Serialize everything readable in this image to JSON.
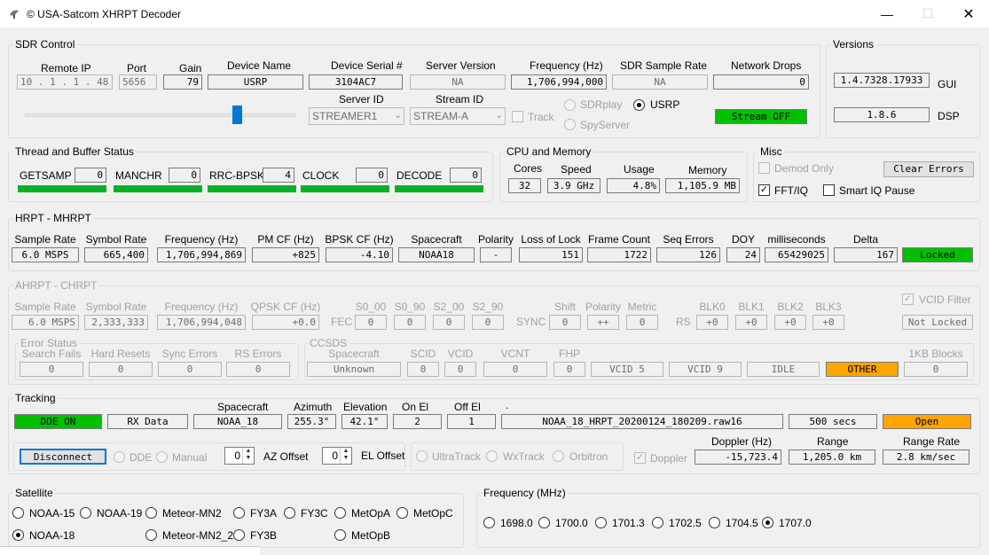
{
  "window": {
    "title": "© USA-Satcom XHRPT Decoder"
  },
  "sdr": {
    "group_title": "SDR Control",
    "remote_ip_label": "Remote IP",
    "remote_ip": "10 . 1 . 1 . 48",
    "port_label": "Port",
    "port": "5656",
    "gain_label": "Gain",
    "gain": "79",
    "device_name_label": "Device Name",
    "device_name": "USRP",
    "device_serial_label": "Device Serial #",
    "device_serial": "3104AC7",
    "server_version_label": "Server Version",
    "server_version": "NA",
    "frequency_label": "Frequency (Hz)",
    "frequency": "1,706,994,000",
    "sample_rate_label": "SDR Sample Rate",
    "sample_rate": "NA",
    "network_drops_label": "Network Drops",
    "network_drops": "0",
    "server_id_label": "Server ID",
    "server_id": "STREAMER1",
    "stream_id_label": "Stream ID",
    "stream_id": "STREAM-A",
    "track_label": "Track",
    "sdrplay_label": "SDRplay",
    "spyserver_label": "SpyServer",
    "usrp_label": "USRP",
    "stream_status": "Stream OFF"
  },
  "versions": {
    "group_title": "Versions",
    "gui": "1.4.7328.17933",
    "gui_label": "GUI",
    "dsp": "1.8.6",
    "dsp_label": "DSP"
  },
  "threads": {
    "group_title": "Thread and Buffer Status",
    "items": [
      {
        "label": "GETSAMP",
        "value": "0"
      },
      {
        "label": "MANCHR",
        "value": "0"
      },
      {
        "label": "RRC-BPSK",
        "value": "4"
      },
      {
        "label": "CLOCK",
        "value": "0"
      },
      {
        "label": "DECODE",
        "value": "0"
      }
    ]
  },
  "cpu": {
    "group_title": "CPU and Memory",
    "cores_label": "Cores",
    "cores": "32",
    "speed_label": "Speed",
    "speed": "3.9 GHz",
    "usage_label": "Usage",
    "usage": "4.8%",
    "memory_label": "Memory",
    "memory": "1,105.9 MB"
  },
  "misc": {
    "group_title": "Misc",
    "demod_only": "Demod Only",
    "clear_errors": "Clear Errors",
    "fft_iq": "FFT/IQ",
    "smart_iq": "Smart IQ Pause"
  },
  "hrpt": {
    "group_title": "HRPT - MHRPT",
    "labels": [
      "Sample Rate",
      "Symbol Rate",
      "Frequency (Hz)",
      "PM CF (Hz)",
      "BPSK CF (Hz)",
      "Spacecraft",
      "Polarity",
      "Loss of Lock",
      "Frame Count",
      "Seq Errors",
      "DOY",
      "milliseconds",
      "Delta"
    ],
    "values": [
      "6.0 MSPS",
      "665,400",
      "1,706,994,869",
      "+825",
      "-4.10",
      "NOAA18",
      "-",
      "151",
      "1722",
      "126",
      "24",
      "65429025",
      "167"
    ],
    "status": "Locked"
  },
  "ahrpt": {
    "group_title": "AHRPT - CHRPT",
    "labels": [
      "Sample Rate",
      "Symbol Rate",
      "Frequency (Hz)",
      "QPSK CF (Hz)",
      "S0_00",
      "S0_90",
      "S2_00",
      "S2_90",
      "Shift",
      "Polarity",
      "Metric",
      "BLK0",
      "BLK1",
      "BLK2",
      "BLK3"
    ],
    "values": [
      "6.0 MSPS",
      "2,333,333",
      "1,706,994,048",
      "+0.0",
      "0",
      "0",
      "0",
      "0",
      "0",
      "++",
      "0",
      "+0",
      "+0",
      "+0",
      "+0"
    ],
    "fec": "FEC",
    "sync": "SYNC",
    "rs": "RS",
    "vcid_filter": "VCID Filter",
    "vcid_status": "Not Locked",
    "error_status_title": "Error Status",
    "err_labels": [
      "Search Fails",
      "Hard Resets",
      "Sync Errors",
      "RS Errors"
    ],
    "err_values": [
      "0",
      "0",
      "0",
      "0"
    ],
    "ccsds_title": "CCSDS",
    "ccsds_labels": [
      "Spacecraft",
      "SCID",
      "VCID",
      "VCNT",
      "FHP",
      "1KB Blocks"
    ],
    "ccsds_values": [
      "Unknown",
      "0",
      "0",
      "0",
      "0",
      "0"
    ],
    "vc_tags": [
      "VCID 5",
      "VCID 9",
      "IDLE",
      "OTHER"
    ]
  },
  "tracking": {
    "group_title": "Tracking",
    "dde_on": "DDE ON",
    "rx_data": "RX Data",
    "spacecraft_label": "Spacecraft",
    "spacecraft": "NOAA_18",
    "azimuth_label": "Azimuth",
    "azimuth": "255.3°",
    "elevation_label": "Elevation",
    "elevation": "42.1°",
    "on_el_label": "On El",
    "on_el": "2",
    "off_el_label": "Off El",
    "off_el": "1",
    "file_label": ".",
    "file": "NOAA_18_HRPT_20200124_180209.raw16",
    "secs": "500 secs",
    "open": "Open",
    "disconnect": "Disconnect",
    "dde": "DDE",
    "manual": "Manual",
    "az_offset_label": "AZ Offset",
    "az_offset": "0",
    "el_offset_label": "EL Offset",
    "el_offset": "0",
    "ultratrack": "UltraTrack",
    "wxtrack": "WxTrack",
    "orbitron": "Orbitron",
    "doppler_chk": "Doppler",
    "doppler_label": "Doppler (Hz)",
    "doppler": "-15,723.4",
    "range_label": "Range",
    "range": "1,205.0 km",
    "range_rate_label": "Range Rate",
    "range_rate": "2.8 km/sec"
  },
  "satellite": {
    "group_title": "Satellite",
    "options": [
      "NOAA-15",
      "NOAA-19",
      "Meteor-MN2",
      "FY3A",
      "FY3C",
      "MetOpA",
      "MetOpC",
      "NOAA-18",
      "Meteor-MN2_2",
      "FY3B",
      "MetOpB"
    ],
    "selected": "NOAA-18"
  },
  "frequency": {
    "group_title": "Frequency (MHz)",
    "options": [
      "1698.0",
      "1700.0",
      "1701.3",
      "1702.5",
      "1704.5",
      "1707.0"
    ],
    "selected": "1707.0"
  },
  "colors": {
    "green": "#00c000",
    "orange": "#ffa500",
    "bar": "#06b025"
  }
}
